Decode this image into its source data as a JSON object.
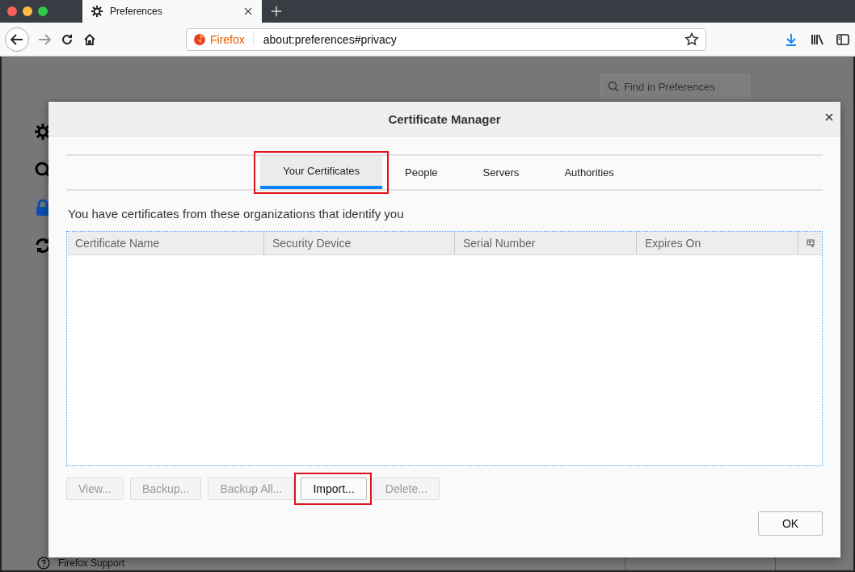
{
  "browser_tab": {
    "title": "Preferences"
  },
  "address_bar": {
    "identity": "Firefox",
    "url": "about:preferences#privacy"
  },
  "page": {
    "search": {
      "placeholder": "Find in Preferences"
    },
    "footer_link": "Firefox Support"
  },
  "dialog": {
    "title": "Certificate Manager",
    "tabs": [
      {
        "label": "Your Certificates",
        "selected": true,
        "highlighted": true
      },
      {
        "label": "People",
        "selected": false,
        "highlighted": false
      },
      {
        "label": "Servers",
        "selected": false,
        "highlighted": false
      },
      {
        "label": "Authorities",
        "selected": false,
        "highlighted": false
      }
    ],
    "description": "You have certificates from these organizations that identify you",
    "table": {
      "columns": [
        "Certificate Name",
        "Security Device",
        "Serial Number",
        "Expires On"
      ]
    },
    "buttons": [
      {
        "label": "View...",
        "disabled": true,
        "highlighted": false
      },
      {
        "label": "Backup...",
        "disabled": true,
        "highlighted": false
      },
      {
        "label": "Backup All...",
        "disabled": true,
        "highlighted": false
      },
      {
        "label": "Import...",
        "disabled": false,
        "highlighted": true
      },
      {
        "label": "Delete...",
        "disabled": true,
        "highlighted": false
      }
    ],
    "ok_button": "OK"
  }
}
